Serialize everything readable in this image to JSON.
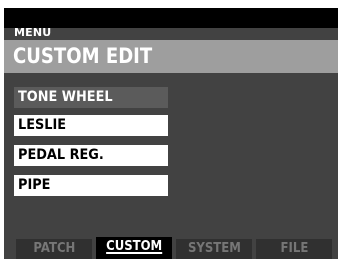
{
  "header": {
    "menu_label": "MENU",
    "title": "CUSTOM EDIT"
  },
  "menu": {
    "items": [
      {
        "label": "TONE WHEEL",
        "selected": true
      },
      {
        "label": "LESLIE",
        "selected": false
      },
      {
        "label": "PEDAL REG.",
        "selected": false
      },
      {
        "label": "PIPE",
        "selected": false
      }
    ]
  },
  "footer": {
    "tabs": [
      {
        "label": "PATCH",
        "active": false
      },
      {
        "label": "CUSTOM",
        "active": true
      },
      {
        "label": "SYSTEM",
        "active": false
      },
      {
        "label": "FILE",
        "active": false
      }
    ]
  },
  "colors": {
    "screen_background": "#424242",
    "title_band": "#9e9e9e",
    "selected_item": "#5b5b5b",
    "item_background": "#ffffff",
    "inactive_tab_text": "#767676",
    "active_tab_background": "#000000"
  }
}
